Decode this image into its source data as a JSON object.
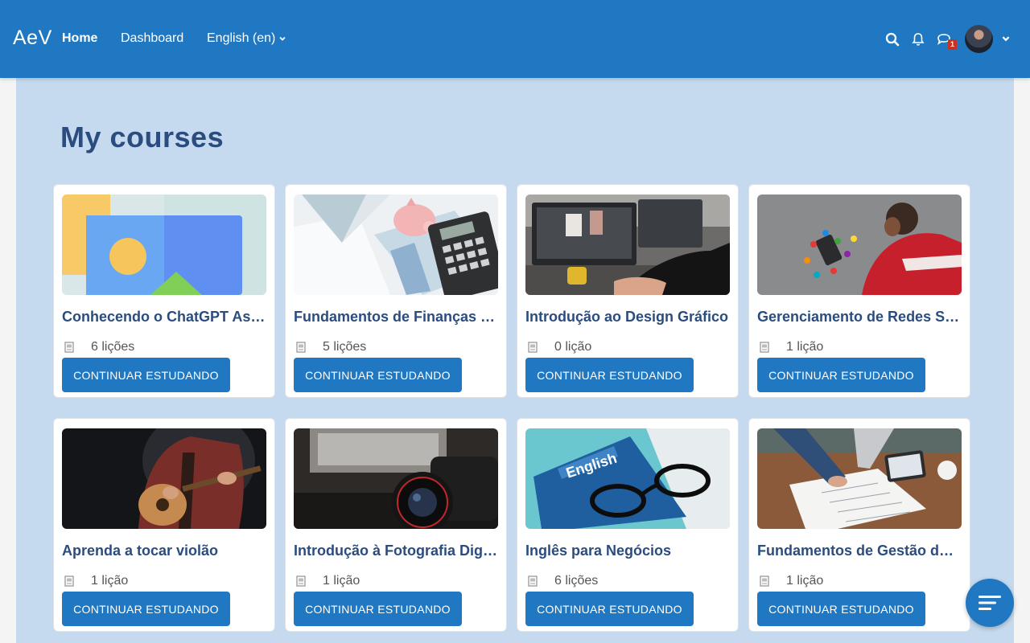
{
  "navbar": {
    "brand": "AeV",
    "links": {
      "home": "Home",
      "dashboard": "Dashboard",
      "language": "English (en)"
    },
    "icons": {
      "search": "search-icon",
      "notifications": "bell-icon",
      "messages": "chat-icon",
      "user_menu": "chevron-down-icon"
    },
    "message_count": "1",
    "colors": {
      "bar": "#1f78c1",
      "badge": "#ca3120"
    }
  },
  "page": {
    "title": "My courses",
    "background": "#c5daee",
    "title_color": "#2b4c7e"
  },
  "courses": [
    {
      "title": "Conhecendo o ChatGPT Assi…",
      "lessons": "6 lições",
      "button": "CONTINUAR ESTUDANDO",
      "image": "placeholder-image"
    },
    {
      "title": "Fundamentos de Finanças Pe…",
      "lessons": "5 lições",
      "button": "CONTINUAR ESTUDANDO",
      "image": "piggy-bank-calculator-photo"
    },
    {
      "title": "Introdução ao Design Gráfico",
      "lessons": "0 lição",
      "button": "CONTINUAR ESTUDANDO",
      "image": "designer-workstation-photo"
    },
    {
      "title": "Gerenciamento de Redes Soc…",
      "lessons": "1 lição",
      "button": "CONTINUAR ESTUDANDO",
      "image": "social-media-phone-photo"
    },
    {
      "title": "Aprenda a tocar violão",
      "lessons": "1 lição",
      "button": "CONTINUAR ESTUDANDO",
      "image": "guitar-player-photo"
    },
    {
      "title": "Introdução à Fotografia Digital",
      "lessons": "1 lição",
      "button": "CONTINUAR ESTUDANDO",
      "image": "camera-lens-photo"
    },
    {
      "title": "Inglês para Negócios",
      "lessons": "6 lições",
      "button": "CONTINUAR ESTUDANDO",
      "image": "english-book-glasses-photo"
    },
    {
      "title": "Fundamentos de Gestão de P…",
      "lessons": "1 lição",
      "button": "CONTINUAR ESTUDANDO",
      "image": "team-planning-photo"
    }
  ],
  "fab": {
    "icon": "drawer-menu-icon"
  }
}
